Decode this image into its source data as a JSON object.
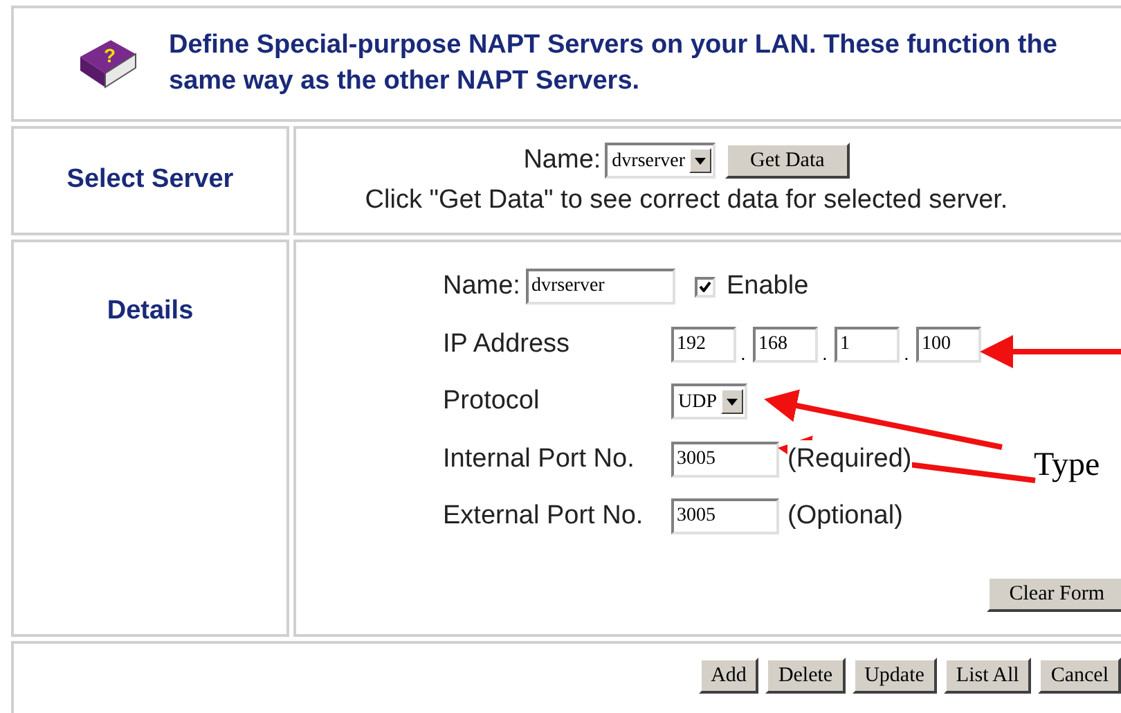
{
  "header": {
    "icon_glyph": "?",
    "text": "Define Special-purpose NAPT Servers on your LAN. These function the same way as the other NAPT Servers."
  },
  "select_server": {
    "heading": "Select Server",
    "name_label": "Name:",
    "name_value": "dvrserver",
    "get_data_button": "Get Data",
    "hint": "Click \"Get Data\" to see correct data for selected server."
  },
  "details": {
    "heading": "Details",
    "name_label": "Name:",
    "name_value": "dvrserver",
    "enable": {
      "label": "Enable",
      "checked": true
    },
    "ip_label": "IP Address",
    "ip_separator": ".",
    "ip_octets": [
      "192",
      "168",
      "1",
      "100"
    ],
    "protocol_label": "Protocol",
    "protocol_value": "UDP",
    "internal_label": "Internal Port No.",
    "internal_value": "3005",
    "internal_note": "(Required)",
    "external_label": "External Port No.",
    "external_value": "3005",
    "external_note": "(Optional)",
    "clear_button": "Clear Form"
  },
  "buttons": [
    "Add",
    "Delete",
    "Update",
    "List All",
    "Cancel"
  ],
  "annotation": {
    "text": "Type"
  }
}
